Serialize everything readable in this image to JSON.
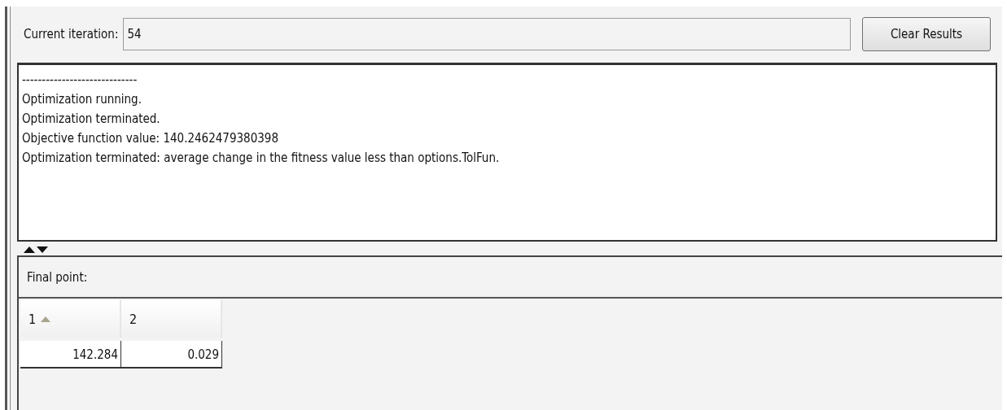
{
  "iteration": {
    "label": "Current iteration:",
    "value": "54"
  },
  "clear_button": {
    "label": "Clear Results"
  },
  "log_lines": [
    "-----------------------------",
    "Optimization running.",
    "Optimization terminated.",
    "Objective function value: 140.2462479380398",
    "Optimization terminated: average change in the fitness value less than options.TolFun."
  ],
  "final_point": {
    "title": "Final point:",
    "columns": [
      {
        "label": "1",
        "sorted": true
      },
      {
        "label": "2",
        "sorted": false
      }
    ],
    "rows": [
      [
        "142.284",
        "0.029"
      ]
    ]
  }
}
